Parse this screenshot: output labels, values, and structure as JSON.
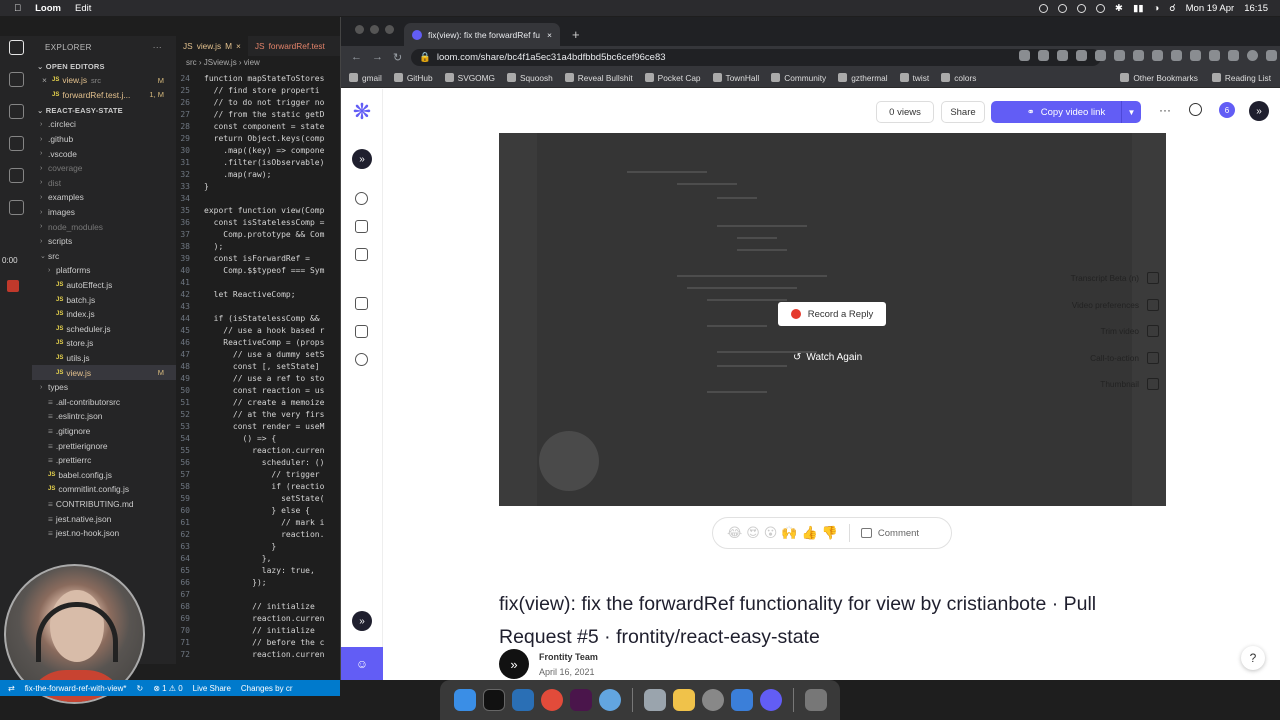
{
  "menubar": {
    "app": "Loom",
    "menu": "Edit",
    "date": "Mon 19 Apr",
    "time": "16:15"
  },
  "vscode": {
    "timer": "0:00",
    "explorer_title": "EXPLORER",
    "open_editors_label": "OPEN EDITORS",
    "open_editors": [
      {
        "name": "view.js",
        "path": "src",
        "badge": "M"
      },
      {
        "name": "forwardRef.test.j...",
        "path": "",
        "badge": "1, M"
      }
    ],
    "project_label": "REACT-EASY-STATE",
    "files": [
      {
        "name": ".circleci",
        "type": "folder"
      },
      {
        "name": ".github",
        "type": "folder"
      },
      {
        "name": ".vscode",
        "type": "folder"
      },
      {
        "name": "coverage",
        "type": "folder",
        "dim": true
      },
      {
        "name": "dist",
        "type": "folder",
        "dim": true
      },
      {
        "name": "examples",
        "type": "folder"
      },
      {
        "name": "images",
        "type": "folder"
      },
      {
        "name": "node_modules",
        "type": "folder",
        "dim": true
      },
      {
        "name": "scripts",
        "type": "folder"
      },
      {
        "name": "src",
        "type": "folder-open"
      },
      {
        "name": "platforms",
        "type": "folder",
        "indent": 1
      },
      {
        "name": "autoEffect.js",
        "type": "js",
        "indent": 1
      },
      {
        "name": "batch.js",
        "type": "js",
        "indent": 1
      },
      {
        "name": "index.js",
        "type": "js",
        "indent": 1
      },
      {
        "name": "scheduler.js",
        "type": "js",
        "indent": 1
      },
      {
        "name": "store.js",
        "type": "js",
        "indent": 1
      },
      {
        "name": "utils.js",
        "type": "js",
        "indent": 1
      },
      {
        "name": "view.js",
        "type": "js",
        "indent": 1,
        "badge": "M",
        "selected": true
      },
      {
        "name": "types",
        "type": "folder"
      },
      {
        "name": ".all-contributorsrc",
        "type": "file"
      },
      {
        "name": ".eslintrc.json",
        "type": "file"
      },
      {
        "name": ".gitignore",
        "type": "file"
      },
      {
        "name": ".prettierignore",
        "type": "file"
      },
      {
        "name": ".prettierrc",
        "type": "file"
      },
      {
        "name": "babel.config.js",
        "type": "js"
      },
      {
        "name": "commitlint.config.js",
        "type": "js"
      },
      {
        "name": "CONTRIBUTING.md",
        "type": "file"
      },
      {
        "name": "jest.native.json",
        "type": "file"
      },
      {
        "name": "jest.no-hook.json",
        "type": "file"
      }
    ],
    "tabs": [
      {
        "label": "view.js",
        "badge": "M"
      },
      {
        "label": "forwardRef.test"
      }
    ],
    "breadcrumb": [
      "src",
      "view.js",
      "view"
    ],
    "code_lines": [
      {
        "n": "24",
        "t": "function mapStateToStores"
      },
      {
        "n": "25",
        "t": "  // find store properti"
      },
      {
        "n": "26",
        "t": "  // to do not trigger no"
      },
      {
        "n": "27",
        "t": "  // from the static getD"
      },
      {
        "n": "28",
        "t": "  const component = state"
      },
      {
        "n": "29",
        "t": "  return Object.keys(comp"
      },
      {
        "n": "30",
        "t": "    .map((key) => compone"
      },
      {
        "n": "31",
        "t": "    .filter(isObservable)"
      },
      {
        "n": "32",
        "t": "    .map(raw);"
      },
      {
        "n": "33",
        "t": "}"
      },
      {
        "n": "34",
        "t": ""
      },
      {
        "n": "35",
        "t": "export function view(Comp"
      },
      {
        "n": "36",
        "t": "  const isStatelessComp ="
      },
      {
        "n": "37",
        "t": "    Comp.prototype && Com"
      },
      {
        "n": "38",
        "t": "  );"
      },
      {
        "n": "39",
        "t": "  const isForwardRef ="
      },
      {
        "n": "40",
        "t": "    Comp.$$typeof === Sym"
      },
      {
        "n": "41",
        "t": ""
      },
      {
        "n": "42",
        "t": "  let ReactiveComp;"
      },
      {
        "n": "43",
        "t": ""
      },
      {
        "n": "44",
        "t": "  if (isStatelessComp &&"
      },
      {
        "n": "45",
        "t": "    // use a hook based r"
      },
      {
        "n": "46",
        "t": "    ReactiveComp = (props"
      },
      {
        "n": "47",
        "t": "      // use a dummy setS"
      },
      {
        "n": "48",
        "t": "      const [, setState]"
      },
      {
        "n": "49",
        "t": "      // use a ref to sto"
      },
      {
        "n": "50",
        "t": "      const reaction = us"
      },
      {
        "n": "51",
        "t": "      // create a memoize"
      },
      {
        "n": "52",
        "t": "      // at the very firs"
      },
      {
        "n": "53",
        "t": "      const render = useM"
      },
      {
        "n": "54",
        "t": "        () => {"
      },
      {
        "n": "55",
        "t": "          reaction.curren"
      },
      {
        "n": "56",
        "t": "            scheduler: ()"
      },
      {
        "n": "57",
        "t": "              // trigger"
      },
      {
        "n": "58",
        "t": "              if (reactio"
      },
      {
        "n": "59",
        "t": "                setState("
      },
      {
        "n": "60",
        "t": "              } else {"
      },
      {
        "n": "61",
        "t": "                // mark i"
      },
      {
        "n": "62",
        "t": "                reaction."
      },
      {
        "n": "63",
        "t": "              }"
      },
      {
        "n": "64",
        "t": "            },"
      },
      {
        "n": "65",
        "t": "            lazy: true,"
      },
      {
        "n": "66",
        "t": "          });"
      },
      {
        "n": "67",
        "t": ""
      },
      {
        "n": "68",
        "t": "          // initialize"
      },
      {
        "n": "69",
        "t": "          reaction.curren"
      },
      {
        "n": "70",
        "t": "          // initialize"
      },
      {
        "n": "71",
        "t": "          // before the c"
      },
      {
        "n": "72",
        "t": "          reaction.curren"
      }
    ],
    "status": {
      "branch": "fix-the-forward-ref-with-view*",
      "problems": "⊗ 1 ⚠ 0",
      "live_share": "Live Share",
      "changes": "Changes by cr"
    }
  },
  "browser": {
    "tab_title": "fix(view): fix the forwardRef fu",
    "url": "loom.com/share/bc4f1a5ec31a4bdfbbd5bc6cef96ce83",
    "bookmarks": [
      "gmail",
      "GitHub",
      "SVGOMG",
      "Squoosh",
      "Reveal Bullshit",
      "Pocket Cap",
      "TownHall",
      "Community",
      "gzthermal",
      "twist",
      "colors"
    ],
    "other_bookmarks": "Other Bookmarks",
    "reading_list": "Reading List"
  },
  "loom": {
    "views": "0 views",
    "share": "Share",
    "copy_link": "Copy video link",
    "notifications_count": "6",
    "record_reply": "Record a Reply",
    "watch_again": "Watch Again",
    "options": [
      {
        "label": "Transcript Beta (n)",
        "icon": "lines-icon"
      },
      {
        "label": "Video preferences",
        "icon": "sliders-icon"
      },
      {
        "label": "Trim video",
        "icon": "scissors-icon"
      },
      {
        "label": "Call-to-action",
        "icon": "cursor-icon"
      },
      {
        "label": "Thumbnail",
        "icon": "image-icon"
      }
    ],
    "reactions": [
      "😂",
      "😍",
      "😮",
      "🙌",
      "👍",
      "👎"
    ],
    "comment": "Comment",
    "title": "fix(view): fix the forwardRef functionality for view by cristianbote · Pull Request #5 · frontity/react-easy-state",
    "author": "Frontity Team",
    "date": "April 16, 2021",
    "help": "?"
  },
  "colors": {
    "loom_purple": "#625df5",
    "vscode_status": "#007acc"
  }
}
